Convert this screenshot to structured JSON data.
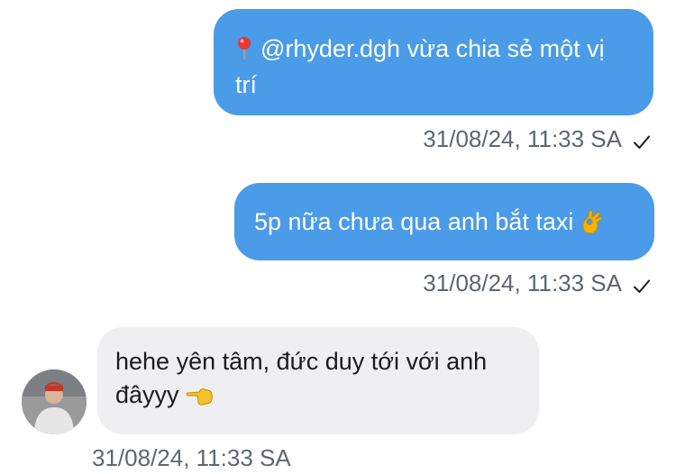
{
  "messages": [
    {
      "direction": "outgoing",
      "mention": "@rhyder.dgh",
      "text_line1_rest": " vừa chia sẻ một vị",
      "text_line2": "trí",
      "icon": "location-pin-icon",
      "timestamp": "31/08/24, 11:33 SA",
      "status_icon": "check-icon"
    },
    {
      "direction": "outgoing",
      "text": "5p nữa chưa qua anh bắt taxi",
      "emoji": "ok-hand-emoji",
      "timestamp": "31/08/24, 11:33 SA",
      "status_icon": "check-icon"
    },
    {
      "direction": "incoming",
      "text_line1": "hehe yên tâm, đức duy tới với anh",
      "text_line2": "đâyyy",
      "emoji": "backhand-point-left-emoji",
      "timestamp": "31/08/24, 11:33 SA",
      "avatar": "sender-avatar"
    }
  ],
  "colors": {
    "outgoing_bubble": "#4a9be8",
    "incoming_bubble": "#efeff2",
    "timestamp": "#5e6673"
  }
}
